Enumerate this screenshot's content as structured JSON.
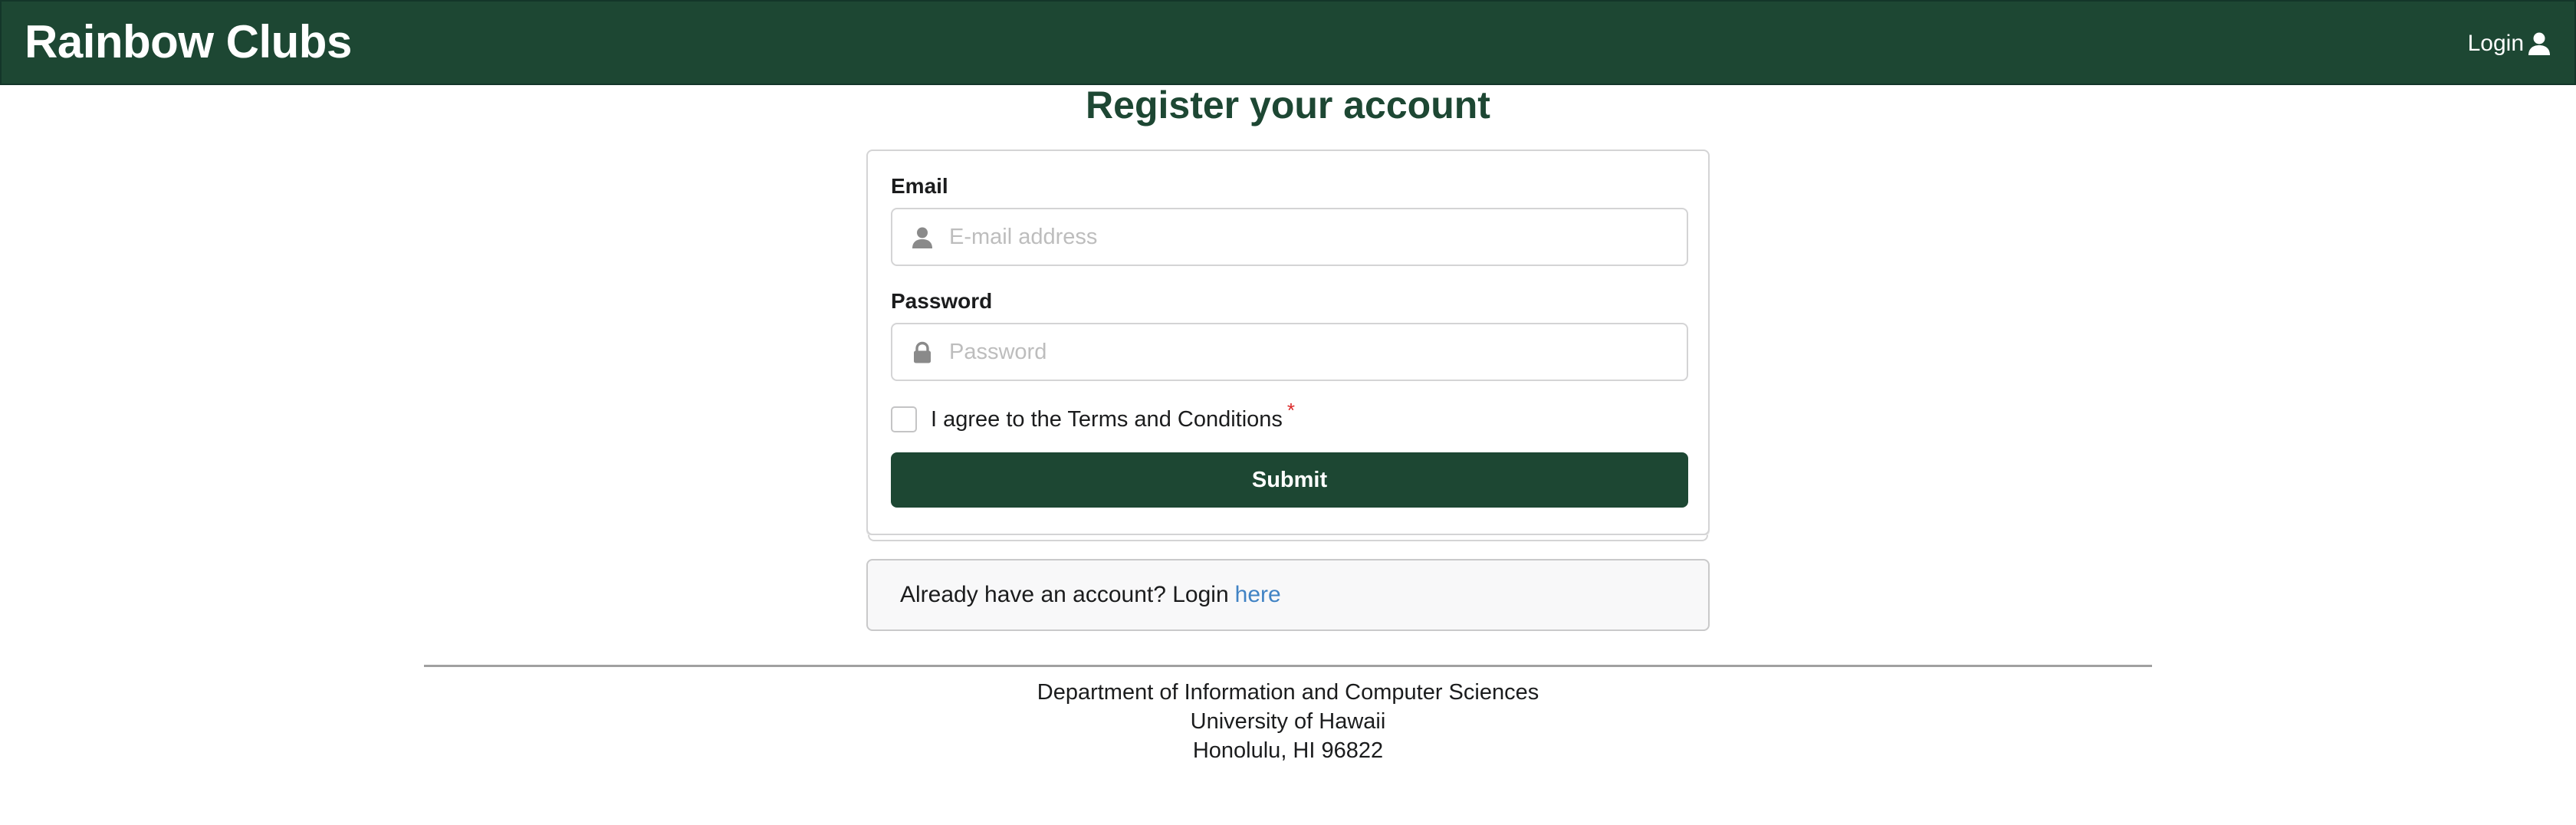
{
  "navbar": {
    "brand": "Rainbow Clubs",
    "login_label": "Login",
    "login_icon": "user-icon",
    "background_color": "#1d4733"
  },
  "page": {
    "title": "Register your account"
  },
  "form": {
    "email": {
      "label": "Email",
      "placeholder": "E-mail address",
      "value": "",
      "icon": "user-icon"
    },
    "password": {
      "label": "Password",
      "placeholder": "Password",
      "value": "",
      "icon": "lock-icon"
    },
    "terms": {
      "label": "I agree to the Terms and Conditions",
      "required_marker": "*",
      "checked": false
    },
    "submit_label": "Submit"
  },
  "message": {
    "text": "Already have an account? Login",
    "link_label": "here"
  },
  "footer": {
    "line1": "Department of Information and Computer Sciences",
    "line2": "University of Hawaii",
    "line3": "Honolulu, HI 96822"
  },
  "colors": {
    "brand_green": "#1d4733",
    "link_blue": "#4183c4",
    "required_red": "#db2828"
  }
}
